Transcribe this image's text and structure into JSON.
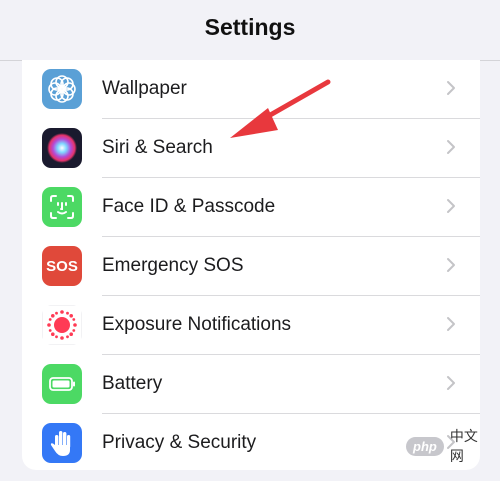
{
  "nav": {
    "title": "Settings"
  },
  "rows": [
    {
      "label": "Wallpaper",
      "icon": "wallpaper-icon",
      "icon_bg": "#5aa0d6"
    },
    {
      "label": "Siri & Search",
      "icon": "siri-icon",
      "icon_bg": "#1a1a2e"
    },
    {
      "label": "Face ID & Passcode",
      "icon": "face-id-icon",
      "icon_bg": "#4cd964"
    },
    {
      "label": "Emergency SOS",
      "icon": "sos-icon",
      "icon_bg": "#e0493a",
      "icon_text": "SOS"
    },
    {
      "label": "Exposure Notifications",
      "icon": "exposure-notifications-icon",
      "icon_bg": "#ffffff"
    },
    {
      "label": "Battery",
      "icon": "battery-icon",
      "icon_bg": "#4cd964"
    },
    {
      "label": "Privacy & Security",
      "icon": "hand-icon",
      "icon_bg": "#3478f6"
    }
  ],
  "annotation": {
    "icon": "red-arrow-icon",
    "color": "#e8383d"
  },
  "watermark": {
    "badge": "php",
    "text": "中文网"
  }
}
